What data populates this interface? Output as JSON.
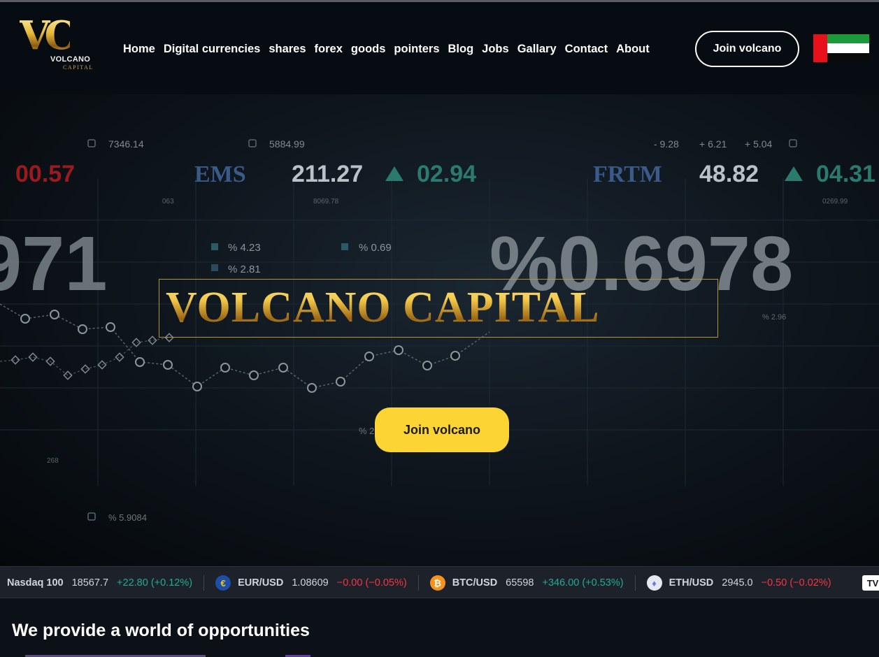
{
  "logo": {
    "mark": "VC",
    "name": "VOLCANO",
    "sub": "CAPITAL"
  },
  "nav": [
    {
      "label": "Home"
    },
    {
      "label": "Digital currencies"
    },
    {
      "label": "shares"
    },
    {
      "label": "forex"
    },
    {
      "label": "goods"
    },
    {
      "label": "pointers"
    },
    {
      "label": "Blog"
    },
    {
      "label": "Jobs"
    },
    {
      "label": "Gallary"
    },
    {
      "label": "Contact"
    },
    {
      "label": "About"
    }
  ],
  "header": {
    "join_label": "Join volcano",
    "language_flag": "uae-flag"
  },
  "hero": {
    "brand_title": "VOLCANO CAPITAL",
    "cta_label": "Join volcano",
    "bg_numbers": {
      "n1": "7346.14",
      "n2": "5884.99",
      "n3": "- 9.28",
      "n4": "+ 6.21",
      "n5": "+ 5.04",
      "n6": "00.57",
      "n7": "EMS",
      "n8": "211.27",
      "n9": "02.94",
      "n10": "FRTM",
      "n11": "48.82",
      "n12": "04.31",
      "n13": "063",
      "n14": "8069.78",
      "n15": "0269.99",
      "n16": "971",
      "n17": "%0.6978",
      "n18": "% 4.23",
      "n19": "% 0.69",
      "n20": "% 2.81",
      "n21": "% 2.96",
      "n22": "268",
      "n23": "% 5.9084",
      "n24": "% 2"
    }
  },
  "ticker": [
    {
      "symbol": "Nasdaq 100",
      "price": "18567.7",
      "change": "+22.80 (+0.12%)",
      "dir": "up",
      "icon": ""
    },
    {
      "symbol": "EUR/USD",
      "price": "1.08609",
      "change": "−0.00 (−0.05%)",
      "dir": "down",
      "icon": "eur-usd-flag-icon"
    },
    {
      "symbol": "BTC/USD",
      "price": "65598",
      "change": "+346.00 (+0.53%)",
      "dir": "up",
      "icon": "bitcoin-icon"
    },
    {
      "symbol": "ETH/USD",
      "price": "2945.0",
      "change": "−0.50 (−0.02%)",
      "dir": "down",
      "icon": "ethereum-icon"
    }
  ],
  "ticker_brand": "TV",
  "section": {
    "title": "We provide a world of opportunities"
  },
  "colors": {
    "accent_yellow": "#fcd535",
    "gold": "#e6b73a",
    "up": "#22ab94",
    "down": "#f23645"
  }
}
